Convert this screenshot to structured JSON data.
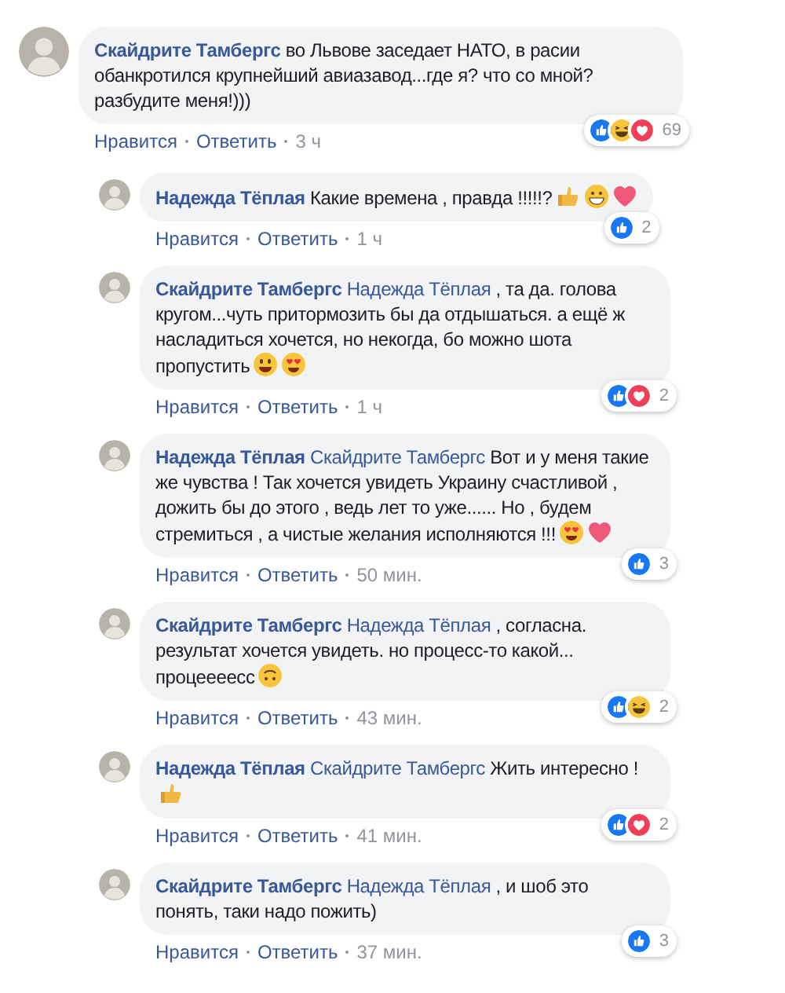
{
  "comment": {
    "author": "Скайдрите Тамбергс",
    "text": "во Львове заседает НАТО, в расии обанкротился крупнейший авиазавод...где я? что со мной? разбудите меня!)))",
    "reactions": [
      {
        "kind": "like"
      },
      {
        "kind": "haha"
      },
      {
        "kind": "love"
      }
    ],
    "reaction_count": "69",
    "actions": {
      "like": "Нравится",
      "reply": "Ответить",
      "time": "3 ч"
    },
    "replies": [
      {
        "author": "Надежда Тёплая",
        "text": "Какие времена , правда !!!!!?",
        "emojis": [
          {
            "kind": "thumbs_up"
          },
          {
            "kind": "grin"
          },
          {
            "kind": "sparkling_heart"
          }
        ],
        "reactions": [
          {
            "kind": "like"
          }
        ],
        "reaction_count": "2",
        "actions": {
          "like": "Нравится",
          "reply": "Ответить",
          "time": "1 ч"
        }
      },
      {
        "author": "Скайдрите Тамбергс",
        "mention": "Надежда Тёплая",
        "text": ", та да. голова кругом...чуть притормозить бы да отдышаться. а ещё ж насладиться хочется, но некогда, бо можно шота пропустить",
        "emojis": [
          {
            "kind": "smile"
          },
          {
            "kind": "heart_eyes"
          }
        ],
        "reactions": [
          {
            "kind": "like"
          },
          {
            "kind": "love"
          }
        ],
        "reaction_count": "2",
        "actions": {
          "like": "Нравится",
          "reply": "Ответить",
          "time": "1 ч"
        }
      },
      {
        "author": "Надежда Тёплая",
        "mention": "Скайдрите Тамбергс",
        "text": "Вот и у меня такие же чувства ! Так хочется увидеть Украину счастливой , дожить бы до этого , ведь лет то уже...... Но , будем стремиться , а чистые желания исполняются !!!",
        "emojis": [
          {
            "kind": "heart_eyes"
          },
          {
            "kind": "sparkling_heart"
          }
        ],
        "reactions": [
          {
            "kind": "like"
          }
        ],
        "reaction_count": "3",
        "actions": {
          "like": "Нравится",
          "reply": "Ответить",
          "time": "50 мин."
        }
      },
      {
        "author": "Скайдрите Тамбергс",
        "mention": "Надежда Тёплая",
        "text": ", согласна. результат хочется увидеть. но процесс-то какой... процеееесс",
        "emojis": [
          {
            "kind": "upside_down"
          }
        ],
        "reactions": [
          {
            "kind": "like"
          },
          {
            "kind": "haha"
          }
        ],
        "reaction_count": "2",
        "actions": {
          "like": "Нравится",
          "reply": "Ответить",
          "time": "43 мин."
        }
      },
      {
        "author": "Надежда Тёплая",
        "mention": "Скайдрите Тамбергс",
        "text": "Жить интересно !",
        "emojis": [
          {
            "kind": "thumbs_up"
          }
        ],
        "reactions": [
          {
            "kind": "like"
          },
          {
            "kind": "love"
          }
        ],
        "reaction_count": "2",
        "actions": {
          "like": "Нравится",
          "reply": "Ответить",
          "time": "41 мин."
        }
      },
      {
        "author": "Скайдрите Тамбергс",
        "mention": "Надежда Тёплая",
        "text": ", и шоб это понять, таки надо пожить)",
        "reactions": [
          {
            "kind": "like"
          }
        ],
        "reaction_count": "3",
        "actions": {
          "like": "Нравится",
          "reply": "Ответить",
          "time": "37 мин."
        }
      }
    ]
  }
}
